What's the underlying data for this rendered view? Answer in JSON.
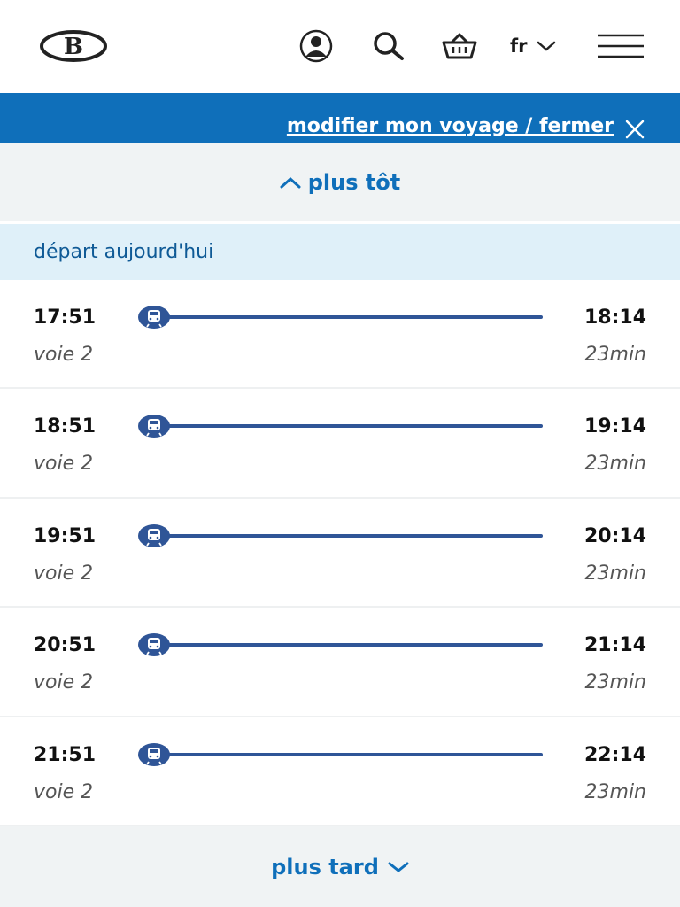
{
  "header": {
    "logo_icon": "sncb-b-logo-icon",
    "icons": [
      "user-icon",
      "search-icon",
      "basket-icon",
      "chevron-down-icon",
      "hamburger-menu-icon"
    ],
    "language": "fr"
  },
  "banner": {
    "modify_link": "modifier mon voyage / fermer"
  },
  "nav": {
    "earlier": "plus tôt",
    "later": "plus tard"
  },
  "day_header": "départ aujourd'hui",
  "trips": [
    {
      "departure": "17:51",
      "arrival": "18:14",
      "platform": "voie 2",
      "duration": "23min"
    },
    {
      "departure": "18:51",
      "arrival": "19:14",
      "platform": "voie 2",
      "duration": "23min"
    },
    {
      "departure": "19:51",
      "arrival": "20:14",
      "platform": "voie 2",
      "duration": "23min"
    },
    {
      "departure": "20:51",
      "arrival": "21:14",
      "platform": "voie 2",
      "duration": "23min"
    },
    {
      "departure": "21:51",
      "arrival": "22:14",
      "platform": "voie 2",
      "duration": "23min"
    }
  ],
  "colors": {
    "brand_blue": "#0f6fba",
    "line_blue": "#2f5597",
    "day_header_bg": "#dff0f9",
    "nav_bg": "#f0f3f4"
  }
}
